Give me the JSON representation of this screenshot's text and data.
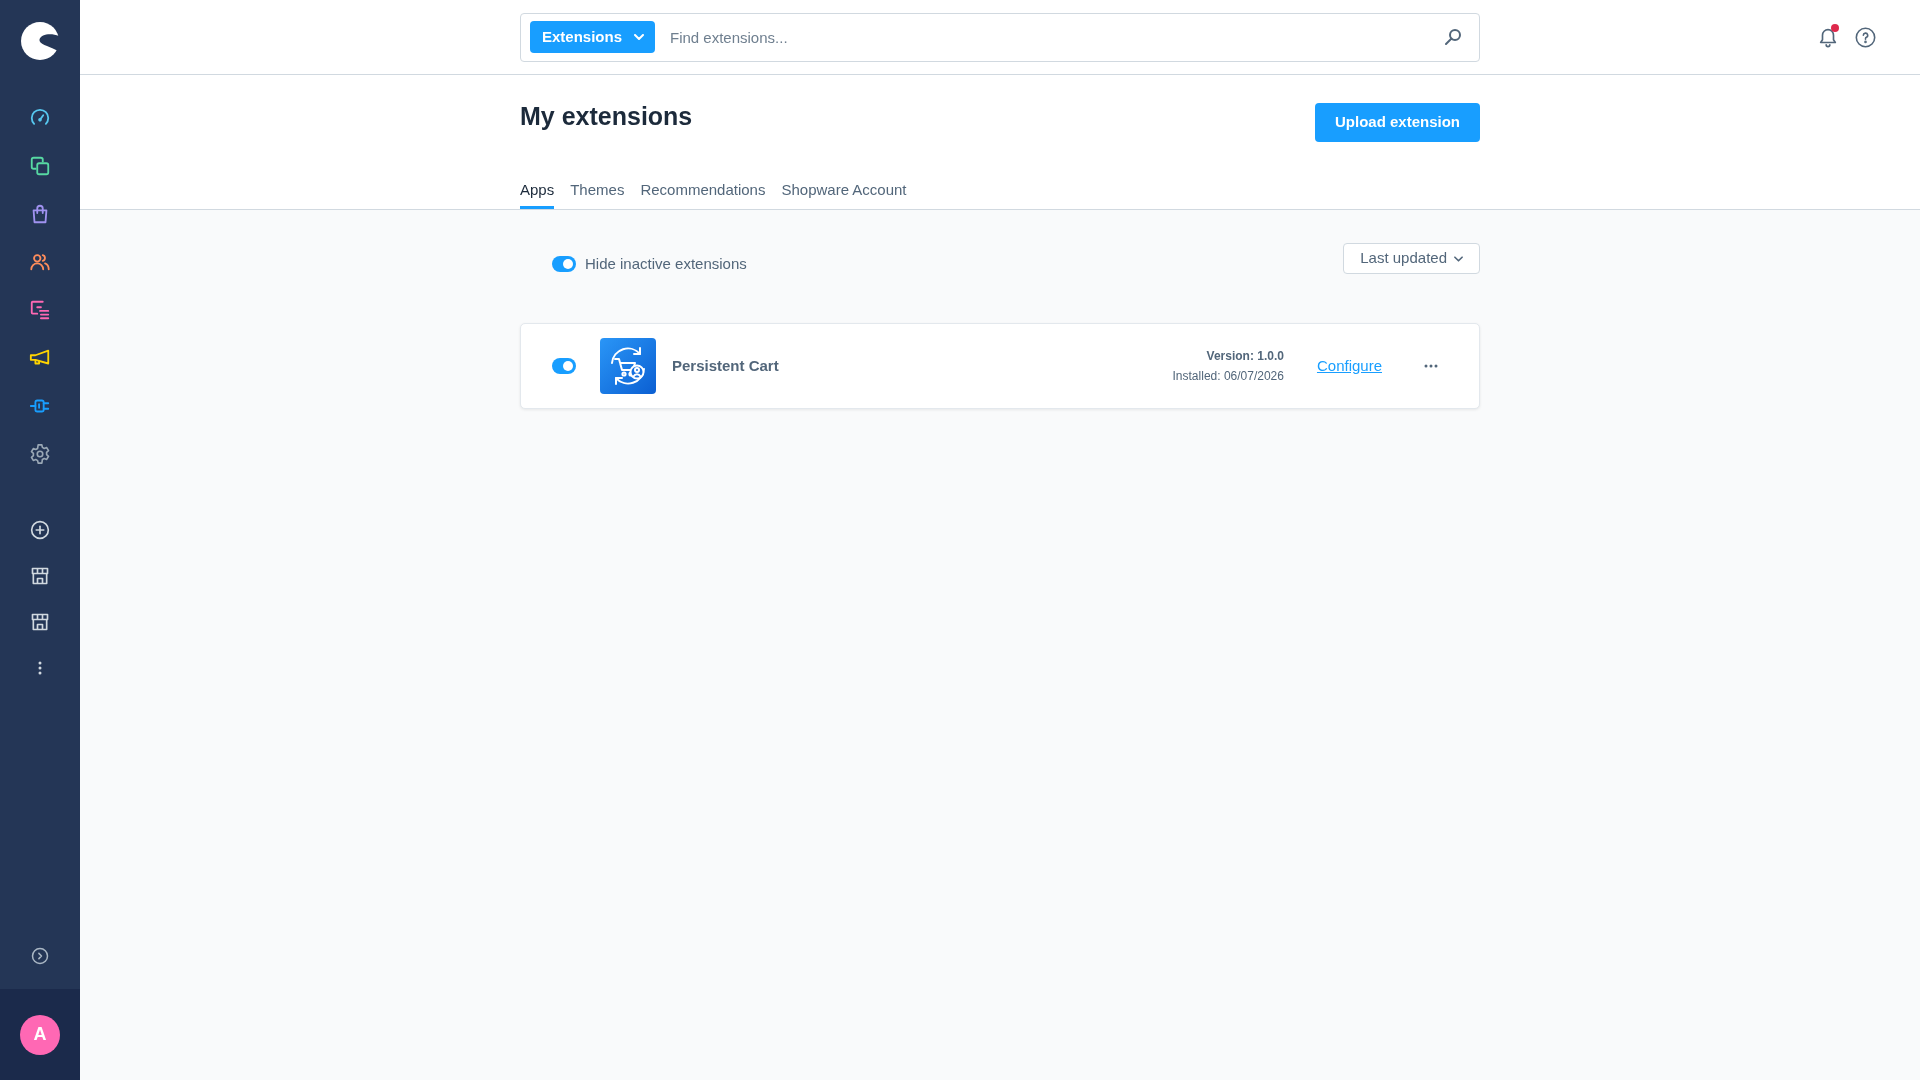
{
  "header": {
    "search": {
      "scope": "Extensions",
      "placeholder": "Find extensions..."
    },
    "notifications": {
      "unread": true
    }
  },
  "page": {
    "title": "My extensions",
    "primary_action": "Upload extension"
  },
  "tabs": [
    {
      "label": "Apps",
      "selected": true
    },
    {
      "label": "Themes",
      "selected": false
    },
    {
      "label": "Recommendations",
      "selected": false
    },
    {
      "label": "Shopware Account",
      "selected": false
    }
  ],
  "filters": {
    "hide_inactive": {
      "label": "Hide inactive extensions",
      "on": true
    },
    "sort": "Last updated"
  },
  "extensions": [
    {
      "name": "Persistent Cart",
      "active": true,
      "version": "Version: 1.0.0",
      "installed": "Installed: 06/07/2026",
      "action": "Configure"
    }
  ],
  "user": {
    "initial": "A"
  }
}
